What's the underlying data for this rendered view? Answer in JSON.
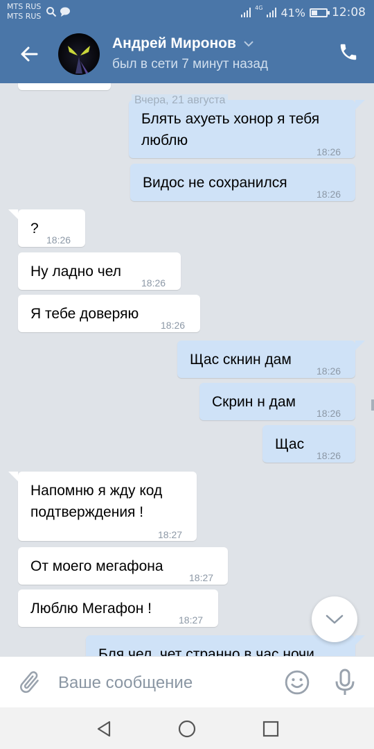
{
  "status_bar": {
    "carrier1": "MTS RUS",
    "carrier2": "MTS RUS",
    "network": "4G",
    "battery_text": "41%",
    "battery_level": 0.41,
    "time": "12:08"
  },
  "header": {
    "name": "Андрей Миронов",
    "status": "был в сети 7 минут назад"
  },
  "chat": {
    "date_separator": "Вчера, 21 августа",
    "messages": [
      {
        "dir": "out",
        "text": "Блять ахуеть хонор я тебя люблю",
        "line1": "Блять ахуеть хонор я тебя",
        "line2": "люблю",
        "time": "18:26"
      },
      {
        "dir": "out",
        "text": "Видос не сохранился",
        "time": "18:26"
      },
      {
        "dir": "in",
        "text": "?",
        "time": "18:26"
      },
      {
        "dir": "in",
        "text": "Ну ладно чел",
        "time": "18:26"
      },
      {
        "dir": "in",
        "text": "Я тебе доверяю",
        "time": "18:26"
      },
      {
        "dir": "out",
        "text": "Щас скнин дам",
        "time": "18:26"
      },
      {
        "dir": "out",
        "text": "Скрин н дам",
        "time": "18:26"
      },
      {
        "dir": "out",
        "text": "Щас",
        "time": "18:26"
      },
      {
        "dir": "in",
        "text": "Напомню я жду код подтверждения !",
        "line1": "Напомню я жду код",
        "line2": "подтверждения !",
        "time": "18:27"
      },
      {
        "dir": "in",
        "text": "От моего мегафона",
        "time": "18:27"
      },
      {
        "dir": "in",
        "text": "Люблю Мегафон !",
        "time": "18:27"
      },
      {
        "dir": "out",
        "text": "Бля чел, чет странно в час ночи",
        "time": ""
      }
    ]
  },
  "composer": {
    "placeholder": "Ваше сообщение",
    "value": ""
  },
  "colors": {
    "header_bg": "#4a76a8",
    "incoming_bubble": "#ffffff",
    "outgoing_bubble": "#cfe2f7",
    "chat_bg": "#dfe3e8"
  },
  "icons": [
    "back-arrow-icon",
    "chevron-down-icon",
    "phone-icon",
    "paperclip-icon",
    "emoji-icon",
    "microphone-icon",
    "scroll-down-icon",
    "nav-back-icon",
    "nav-home-icon",
    "nav-recents-icon"
  ]
}
